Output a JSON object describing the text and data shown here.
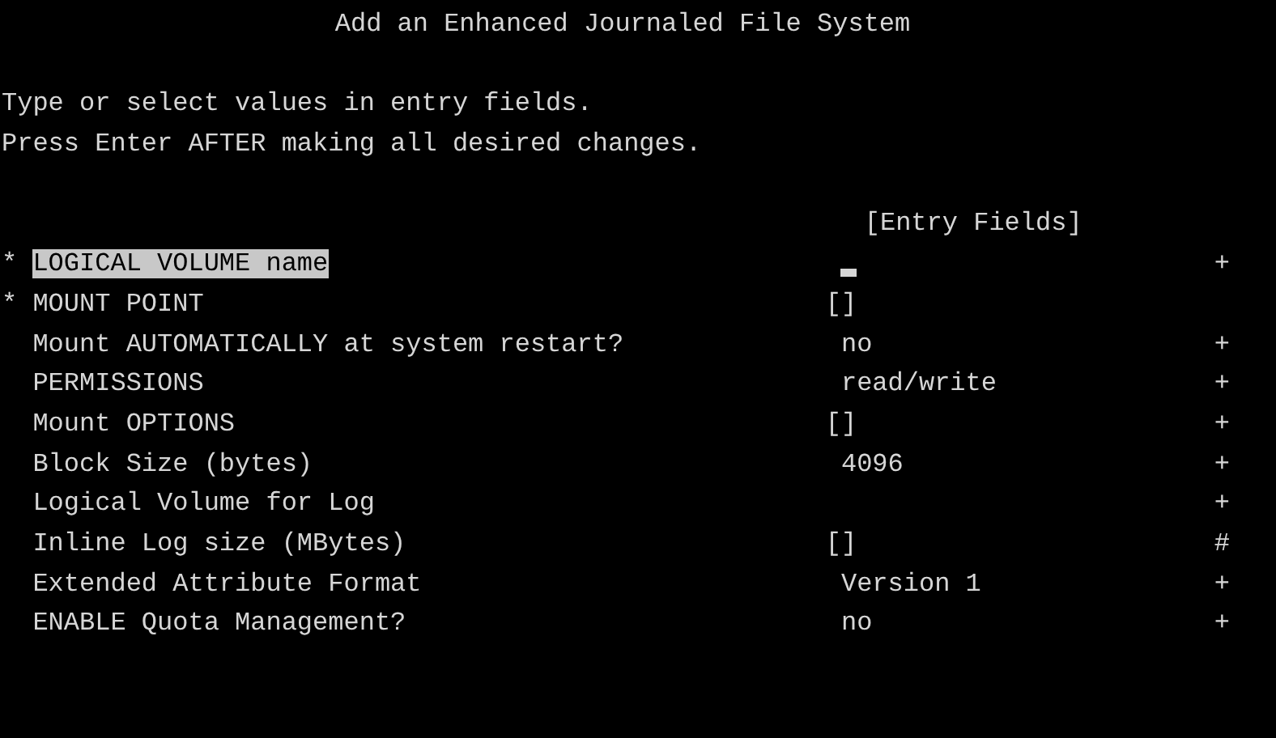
{
  "window": {
    "title": "Add an Enhanced Journaled File System"
  },
  "instructions": [
    "Type or select values in entry fields.",
    "Press Enter AFTER making all desired changes."
  ],
  "column_header": "[Entry Fields]",
  "fields": [
    {
      "required": "*",
      "label": "LOGICAL VOLUME name",
      "selected": true,
      "kind": "cursor",
      "indicator": "+"
    },
    {
      "required": "*",
      "label": "MOUNT POINT",
      "selected": false,
      "kind": "entry",
      "value": "[]"
    },
    {
      "label": "Mount AUTOMATICALLY at system restart?",
      "selected": false,
      "kind": "choice",
      "value": "no",
      "indicator": "+"
    },
    {
      "label": "PERMISSIONS",
      "selected": false,
      "kind": "choice",
      "value": "read/write",
      "indicator": "+"
    },
    {
      "label": "Mount OPTIONS",
      "selected": false,
      "kind": "entry",
      "value": "[]",
      "indicator": "+"
    },
    {
      "label": "Block Size (bytes)",
      "selected": false,
      "kind": "choice",
      "value": "4096",
      "indicator": "+"
    },
    {
      "label": "Logical Volume for Log",
      "selected": false,
      "kind": "choice",
      "indicator": "+"
    },
    {
      "label": "Inline Log size (MBytes)",
      "selected": false,
      "kind": "entry",
      "value": "[]",
      "indicator": "#"
    },
    {
      "label": "Extended Attribute Format",
      "selected": false,
      "kind": "choice",
      "value": "Version 1",
      "indicator": "+"
    },
    {
      "label": "ENABLE Quota Management?",
      "selected": false,
      "kind": "choice",
      "value": "no",
      "indicator": "+"
    }
  ]
}
